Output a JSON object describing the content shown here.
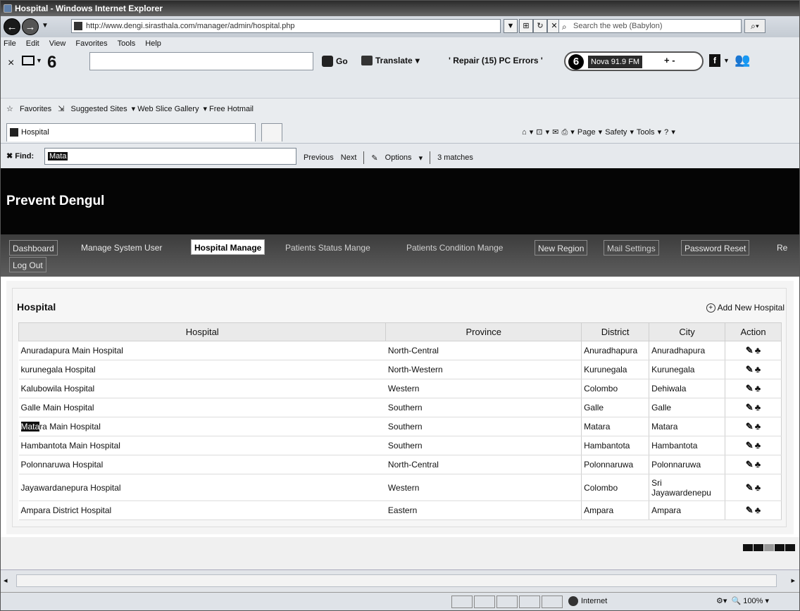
{
  "window": {
    "title": "Hospital - Windows Internet Explorer"
  },
  "address": {
    "url": "http://www.dengi.sirasthala.com/manager/admin/hospital.php",
    "search_placeholder": "Search the web (Babylon)"
  },
  "menu": [
    "File",
    "Edit",
    "View",
    "Favorites",
    "Tools",
    "Help"
  ],
  "toolbar": {
    "go_label": "Go",
    "translate_label": "Translate",
    "repair_label": "' Repair (15) PC Errors '",
    "radio_name": "Nova 91.9 FM",
    "radio_controls": "+ -"
  },
  "favorites": {
    "label": "Favorites",
    "items": [
      "Suggested Sites",
      "Web Slice Gallery",
      "Free Hotmail"
    ]
  },
  "tab": {
    "label": "Hospital"
  },
  "commandbar": "Page ▾   Safety ▾   Tools ▾",
  "findbar": {
    "label": "Find:",
    "value": "Mata",
    "previous": "Previous",
    "next": "Next",
    "options": "Options",
    "matches": "3 matches"
  },
  "site": {
    "title": "Prevent Dengul",
    "nav": [
      "Dashboard",
      "Manage System User",
      "Hospital Manage",
      "Patients Status Mange",
      "Patients Condition Mange",
      "New Region",
      "Mail Settings",
      "Password Reset",
      "Re",
      "Log Out"
    ]
  },
  "panel": {
    "title": "Hospital",
    "add_new": "Add New Hospital",
    "columns": [
      "Hospital",
      "Province",
      "District",
      "City",
      "Action"
    ],
    "rows": [
      {
        "hospital": "Anuradapura Main Hospital",
        "province": "North-Central",
        "district": "Anuradhapura",
        "city": "Anuradhapura"
      },
      {
        "hospital": "kurunegala Hospital",
        "province": "North-Western",
        "district": "Kurunegala",
        "city": "Kurunegala"
      },
      {
        "hospital": "Kalubowila Hospital",
        "province": "Western",
        "district": "Colombo",
        "city": "Dehiwala"
      },
      {
        "hospital": "Galle Main Hospital",
        "province": "Southern",
        "district": "Galle",
        "city": "Galle"
      },
      {
        "hospital_hl": "Mata",
        "hospital_rest": "ra Main Hospital",
        "province": "Southern",
        "district": "Matara",
        "city": "Matara"
      },
      {
        "hospital": "Hambantota Main Hospital",
        "province": "Southern",
        "district": "Hambantota",
        "city": "Hambantota"
      },
      {
        "hospital": "Polonnaruwa Hospital",
        "province": "North-Central",
        "district": "Polonnaruwa",
        "city": "Polonnaruwa"
      },
      {
        "hospital": "Jayawardanepura Hospital",
        "province": "Western",
        "district": "Colombo",
        "city_line1": "Sri",
        "city_line2": "Jayawardenepu"
      },
      {
        "hospital": "Ampara District Hospital",
        "province": "Eastern",
        "district": "Ampara",
        "city": "Ampara"
      }
    ]
  },
  "status": {
    "zone": "Internet",
    "zoom": "100%"
  }
}
